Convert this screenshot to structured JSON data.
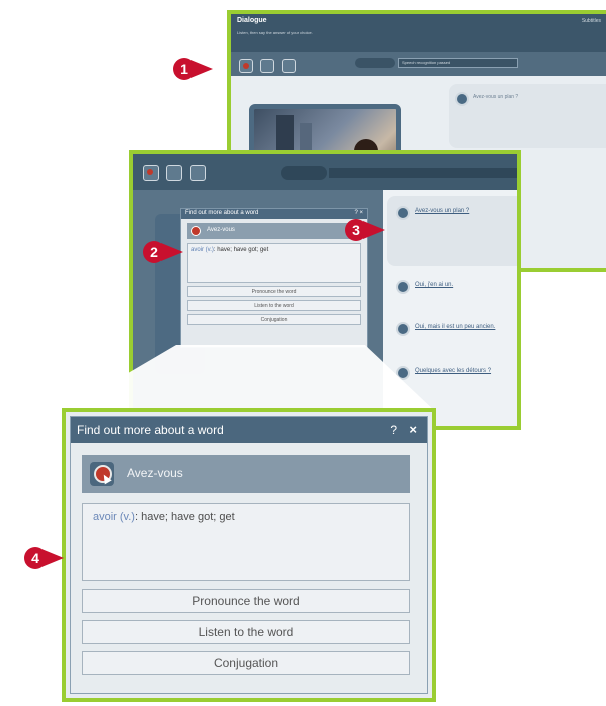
{
  "dialogue_window": {
    "title": "Dialogue",
    "subtitle": "Listen, then say the answer of your choice.",
    "top_right": "Subtitles",
    "search_placeholder": "Speech recognition passed",
    "question_1": "Avez-vous un plan ?"
  },
  "middle_window": {
    "mini_popup": {
      "title": "Find out more about a word",
      "controls": "? ×",
      "word": "Avez-vous",
      "definition_verb": "avoir (v.)",
      "definition_rest": ": have; have got; get",
      "buttons": [
        "Pronounce the word",
        "Listen to the word",
        "Conjugation"
      ]
    },
    "dialogue_lines": [
      "Avez-vous un plan ?",
      "Oui, j'en ai un.",
      "Oui, mais il est un peu ancien.",
      "Quelques avec les détours ?"
    ]
  },
  "word_popup": {
    "title": "Find out more about a word",
    "help": "?",
    "close": "×",
    "word": "Avez-vous",
    "definition_verb": "avoir (v.)",
    "definition_rest": ": have; have got; get",
    "buttons": {
      "pronounce": "Pronounce the word",
      "listen": "Listen to the word",
      "conjugation": "Conjugation"
    }
  },
  "callouts": [
    "1",
    "2",
    "3",
    "4"
  ],
  "colors": {
    "frame_border": "#9acd32",
    "callout": "#c8102e",
    "title_bar": "#4b677e"
  }
}
